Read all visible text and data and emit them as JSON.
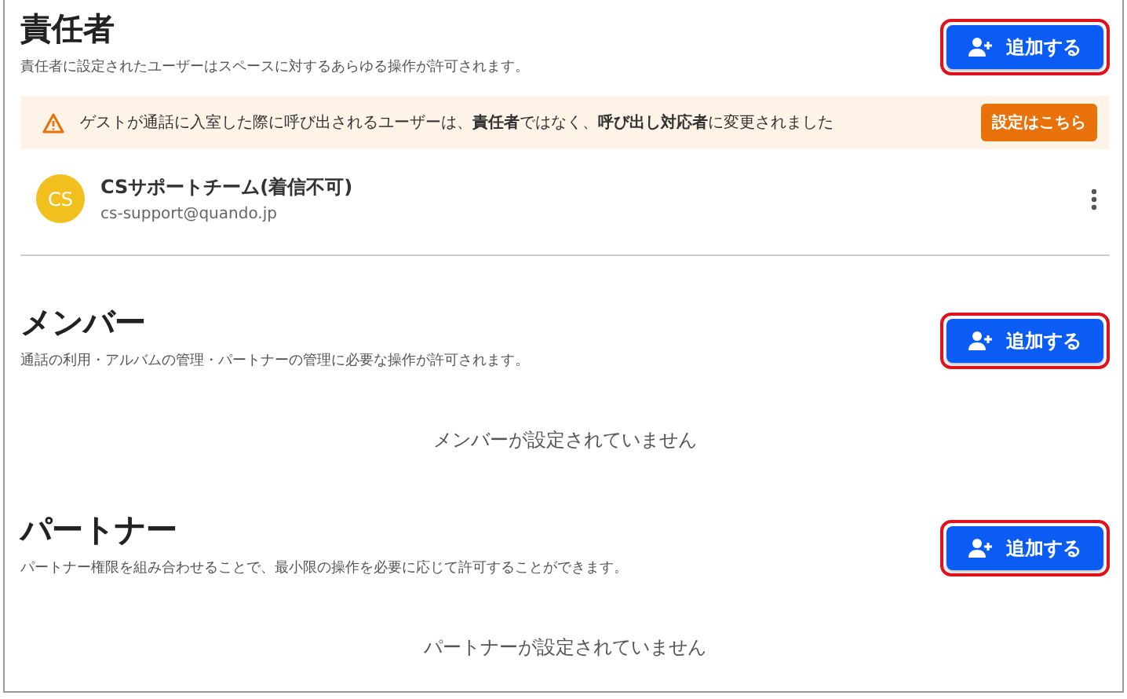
{
  "sections": [
    {
      "title": "責任者",
      "description": "責任者に設定されたユーザーはスペースに対するあらゆる操作が許可されます。",
      "add_button": {
        "label": "追加する",
        "highlighted": true
      },
      "alert": {
        "text": "ゲストが通話に入室した際に呼び出されるユーザーは、**責任者**ではなく、**呼び出し対応者**に変更されました",
        "button": "設定はこちら"
      },
      "users": [
        {
          "initials": "CS",
          "name": "CSサポートチーム(着信不可)",
          "email": "cs-support@quando.jp",
          "color": "#f2c01e"
        }
      ]
    },
    {
      "title": "メンバー",
      "description": "通話の利用・アルバムの管理・パートナーの管理に必要な操作が許可されます。",
      "add_button": {
        "label": "追加する",
        "highlighted": true
      },
      "empty": "メンバーが設定されていません"
    },
    {
      "title": "パートナー",
      "description": "パートナー権限を組み合わせることで、最小限の操作を必要に応じて許可することができます。",
      "add_button": {
        "label": "追加する",
        "highlighted": true
      },
      "empty": "パートナーが設定されていません"
    }
  ]
}
